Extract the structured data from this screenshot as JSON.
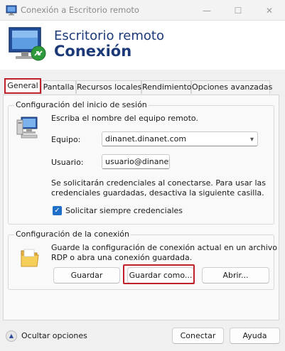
{
  "titlebar": {
    "title": "Conexión a Escritorio remoto",
    "minimize_glyph": "—",
    "maximize_glyph": "☐",
    "close_glyph": "✕"
  },
  "banner": {
    "line1": "Escritorio remoto",
    "line2": "Conexión"
  },
  "tabs": [
    {
      "label": "General",
      "active": true
    },
    {
      "label": "Pantalla",
      "active": false
    },
    {
      "label": "Recursos locales",
      "active": false
    },
    {
      "label": "Rendimiento",
      "active": false
    },
    {
      "label": "Opciones avanzadas",
      "active": false
    }
  ],
  "logon": {
    "group_label": "Configuración del inicio de sesión",
    "instruction": "Escriba el nombre del equipo remoto.",
    "computer_label": "Equipo:",
    "computer_value": "dinanet.dinanet.com",
    "user_label": "Usuario:",
    "user_value": "usuario@dinanet",
    "notice_line1": "Se solicitarán credenciales al conectarse. Para usar las",
    "notice_line2": "credenciales guardadas, desactiva la siguiente casilla.",
    "always_ask_label": "Solicitar siempre credenciales",
    "always_ask_checked": true
  },
  "connection": {
    "group_label": "Configuración de la conexión",
    "desc_line1": "Guarde la configuración de conexión actual en un archivo",
    "desc_line2": "RDP o abra una conexión guardada.",
    "save_label": "Guardar",
    "save_as_label": "Guardar como...",
    "open_label": "Abrir..."
  },
  "footer": {
    "hide_options_label": "Ocultar opciones",
    "connect_label": "Conectar",
    "help_label": "Ayuda"
  },
  "colors": {
    "accent": "#1f6fc8",
    "highlight_border": "#c0202a",
    "banner_text": "#1d3a78"
  },
  "icons": {
    "app": "remote-desktop-icon",
    "computer": "computer-icon",
    "folder": "folder-icon",
    "toggle": "chevron-up-icon"
  }
}
